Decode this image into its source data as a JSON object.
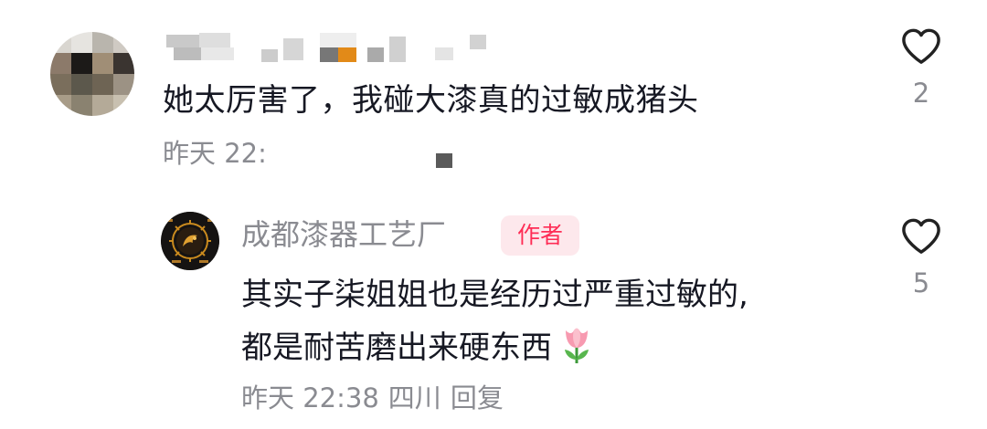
{
  "comment": {
    "text": "她太厉害了，我碰大漆真的过敏成猪头",
    "meta": "昨天 22:",
    "like_count": "2",
    "like_icon": "heart-outline-icon"
  },
  "reply": {
    "author_name": "成都漆器工艺厂",
    "author_badge": "作者",
    "text_line1": "其实子柒姐姐也是经历过严重过敏的,",
    "text_line2": "都是耐苦磨出来硬东西",
    "emoji_icon": "tulip-icon",
    "meta_date": "昨天 22:38",
    "meta_location": "四川",
    "reply_label": "回复",
    "like_count": "5",
    "like_icon": "heart-outline-icon"
  },
  "colors": {
    "text_primary": "#161823",
    "text_secondary": "#8a8b91",
    "badge_bg": "#fde8ec",
    "badge_text": "#fe2c55"
  }
}
